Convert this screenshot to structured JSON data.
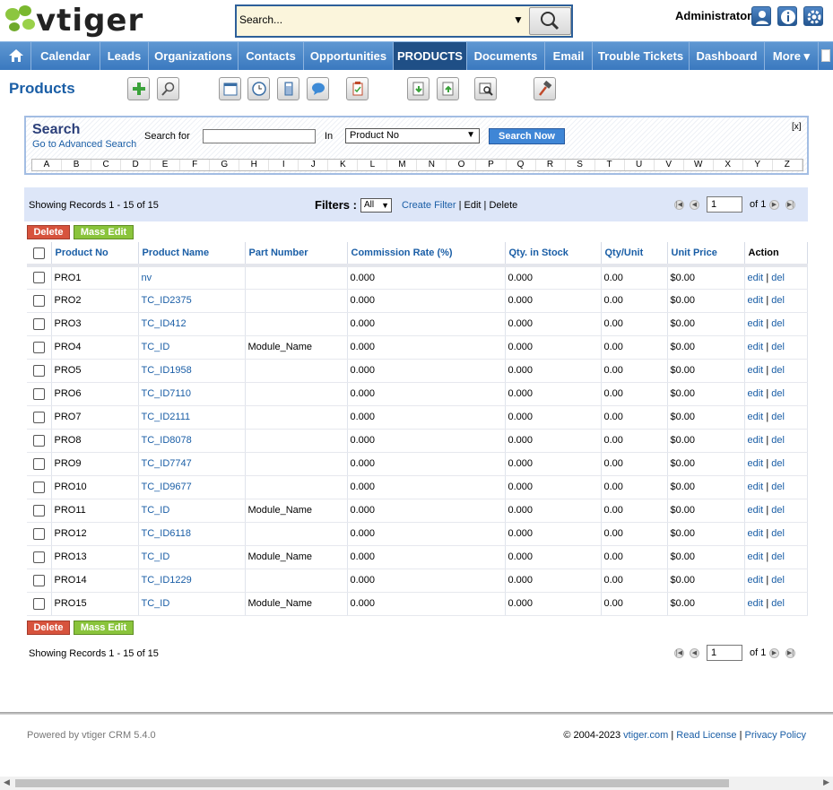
{
  "header": {
    "logo_text": "vtiger",
    "search_placeholder": "Search...",
    "user": "Administrator"
  },
  "nav": {
    "tabs": [
      {
        "label": "Calendar",
        "active": false
      },
      {
        "label": "Leads",
        "active": false
      },
      {
        "label": "Organizations",
        "active": false
      },
      {
        "label": "Contacts",
        "active": false
      },
      {
        "label": "Opportunities",
        "active": false
      },
      {
        "label": "PRODUCTS",
        "active": true
      },
      {
        "label": "Documents",
        "active": false
      },
      {
        "label": "Email",
        "active": false
      },
      {
        "label": "Trouble Tickets",
        "active": false
      },
      {
        "label": "Dashboard",
        "active": false
      },
      {
        "label": "More ▾",
        "active": false
      }
    ]
  },
  "page": {
    "title": "Products"
  },
  "search_panel": {
    "title": "Search",
    "advanced_link": "Go to Advanced Search",
    "search_for_label": "Search for",
    "in_label": "In",
    "field_selected": "Product No",
    "search_button": "Search Now",
    "close": "[x]",
    "alphabet": [
      "A",
      "B",
      "C",
      "D",
      "E",
      "F",
      "G",
      "H",
      "I",
      "J",
      "K",
      "L",
      "M",
      "N",
      "O",
      "P",
      "Q",
      "R",
      "S",
      "T",
      "U",
      "V",
      "W",
      "X",
      "Y",
      "Z"
    ]
  },
  "listing": {
    "showing": "Showing Records 1 - 15 of 15",
    "filters_label": "Filters :",
    "filter_value": "All",
    "create_filter": "Create Filter",
    "edit": "Edit",
    "delete": "Delete",
    "page_value": "1",
    "page_of": "of 1",
    "delete_button": "Delete",
    "mass_edit_button": "Mass Edit"
  },
  "table": {
    "columns": [
      "Product No",
      "Product Name",
      "Part Number",
      "Commission Rate (%)",
      "Qty. in Stock",
      "Qty/Unit",
      "Unit Price",
      "Action"
    ],
    "rows": [
      {
        "no": "PRO1",
        "name": "nv",
        "part": "",
        "commission": "0.000",
        "stock": "0.000",
        "qty_unit": "0.00",
        "price": "$0.00"
      },
      {
        "no": "PRO2",
        "name": "TC_ID2375",
        "part": "",
        "commission": "0.000",
        "stock": "0.000",
        "qty_unit": "0.00",
        "price": "$0.00"
      },
      {
        "no": "PRO3",
        "name": "TC_ID412",
        "part": "",
        "commission": "0.000",
        "stock": "0.000",
        "qty_unit": "0.00",
        "price": "$0.00"
      },
      {
        "no": "PRO4",
        "name": "TC_ID",
        "part": "Module_Name",
        "commission": "0.000",
        "stock": "0.000",
        "qty_unit": "0.00",
        "price": "$0.00"
      },
      {
        "no": "PRO5",
        "name": "TC_ID1958",
        "part": "",
        "commission": "0.000",
        "stock": "0.000",
        "qty_unit": "0.00",
        "price": "$0.00"
      },
      {
        "no": "PRO6",
        "name": "TC_ID7110",
        "part": "",
        "commission": "0.000",
        "stock": "0.000",
        "qty_unit": "0.00",
        "price": "$0.00"
      },
      {
        "no": "PRO7",
        "name": "TC_ID2111",
        "part": "",
        "commission": "0.000",
        "stock": "0.000",
        "qty_unit": "0.00",
        "price": "$0.00"
      },
      {
        "no": "PRO8",
        "name": "TC_ID8078",
        "part": "",
        "commission": "0.000",
        "stock": "0.000",
        "qty_unit": "0.00",
        "price": "$0.00"
      },
      {
        "no": "PRO9",
        "name": "TC_ID7747",
        "part": "",
        "commission": "0.000",
        "stock": "0.000",
        "qty_unit": "0.00",
        "price": "$0.00"
      },
      {
        "no": "PRO10",
        "name": "TC_ID9677",
        "part": "",
        "commission": "0.000",
        "stock": "0.000",
        "qty_unit": "0.00",
        "price": "$0.00"
      },
      {
        "no": "PRO11",
        "name": "TC_ID",
        "part": "Module_Name",
        "commission": "0.000",
        "stock": "0.000",
        "qty_unit": "0.00",
        "price": "$0.00"
      },
      {
        "no": "PRO12",
        "name": "TC_ID6118",
        "part": "",
        "commission": "0.000",
        "stock": "0.000",
        "qty_unit": "0.00",
        "price": "$0.00"
      },
      {
        "no": "PRO13",
        "name": "TC_ID",
        "part": "Module_Name",
        "commission": "0.000",
        "stock": "0.000",
        "qty_unit": "0.00",
        "price": "$0.00"
      },
      {
        "no": "PRO14",
        "name": "TC_ID1229",
        "part": "",
        "commission": "0.000",
        "stock": "0.000",
        "qty_unit": "0.00",
        "price": "$0.00"
      },
      {
        "no": "PRO15",
        "name": "TC_ID",
        "part": "Module_Name",
        "commission": "0.000",
        "stock": "0.000",
        "qty_unit": "0.00",
        "price": "$0.00"
      }
    ],
    "action_edit": "edit",
    "action_sep": "|",
    "action_del": "del"
  },
  "footer": {
    "powered": "Powered by vtiger CRM 5.4.0",
    "copyright": "© 2004-2023",
    "site_link": "vtiger.com",
    "license_link": "Read License",
    "privacy_link": "Privacy Policy"
  },
  "colors": {
    "nav": "#3a79bf",
    "nav_active": "#1f4f86",
    "link": "#1a5ea6",
    "delete_button": "#d7533d",
    "mass_edit_button": "#8ac43c"
  }
}
